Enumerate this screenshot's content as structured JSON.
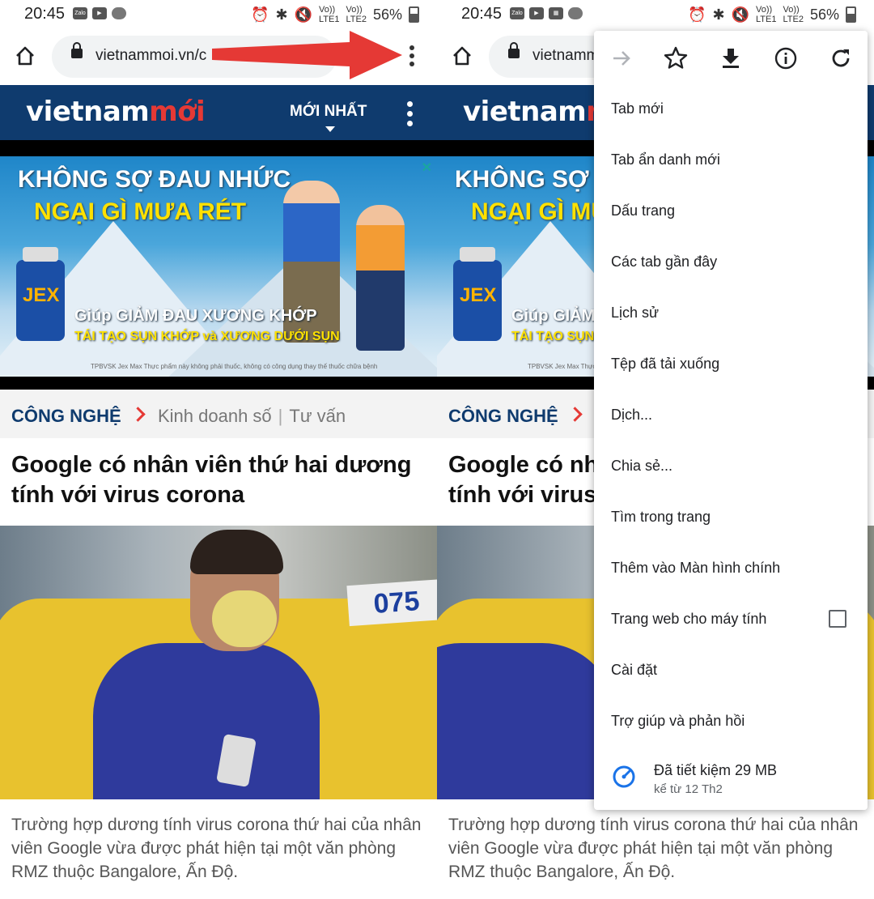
{
  "status": {
    "time": "20:45",
    "battery": "56%",
    "lte1": "LTE1",
    "lte2": "LTE2",
    "volte": "Vo))",
    "app_icons": [
      "Zalo",
      "youtube",
      "cloud"
    ],
    "app_icons_right": [
      "Zalo",
      "youtube",
      "gallery",
      "cloud"
    ]
  },
  "browser": {
    "url": "vietnammoi.vn/c",
    "url_short": "vietnamm"
  },
  "site": {
    "logo_a": "vietnam",
    "logo_b": "mới",
    "latest_label": "MỚI NHẤT"
  },
  "ad": {
    "line1": "KHÔNG SỢ ĐAU NHỨC",
    "line2": "NGẠI GÌ MƯA RÉT",
    "brand": "JEX",
    "line3": "Giúp GIẢM ĐAU XƯƠNG KHỚP",
    "line4": "TÁI TẠO SỤN KHỚP và XƯƠNG DƯỚI SỤN",
    "footnote": "TPBVSK Jex Max Thực phẩm này không phải thuốc, không có công dụng thay thế thuốc chữa bệnh"
  },
  "category": {
    "main": "CÔNG NGHỆ",
    "sub1": "Kinh doanh số",
    "sub2": "Tư vấn",
    "sep": "|"
  },
  "article": {
    "headline": "Google có nhân viên thứ hai dương tính với virus corona",
    "headline_r1": "Google có nh",
    "headline_r2": "tính với virus",
    "taxi_number": "075",
    "description": "Trường hợp dương tính virus corona thứ hai của nhân viên Google vừa được phát hiện tại một văn phòng RMZ thuộc Bangalore, Ấn Độ."
  },
  "menu": {
    "top_icons": [
      "forward-arrow-icon",
      "star-icon",
      "download-icon",
      "info-icon",
      "refresh-icon"
    ],
    "items": [
      "Tab mới",
      "Tab ẩn danh mới",
      "Dấu trang",
      "Các tab gần đây",
      "Lịch sử",
      "Tệp đã tải xuống",
      "Dịch...",
      "Chia sẻ...",
      "Tìm trong trang",
      "Thêm vào Màn hình chính",
      "Trang web cho máy tính",
      "Cài đặt",
      "Trợ giúp và phản hồi"
    ],
    "desktop_site_checked": false,
    "saver_title": "Đã tiết kiệm 29 MB",
    "saver_sub": "kể từ 12 Th2"
  },
  "colors": {
    "site_header": "#0f3b6e",
    "accent_red": "#e53935",
    "arrow": "#e53935",
    "saver_blue": "#1a73e8"
  }
}
